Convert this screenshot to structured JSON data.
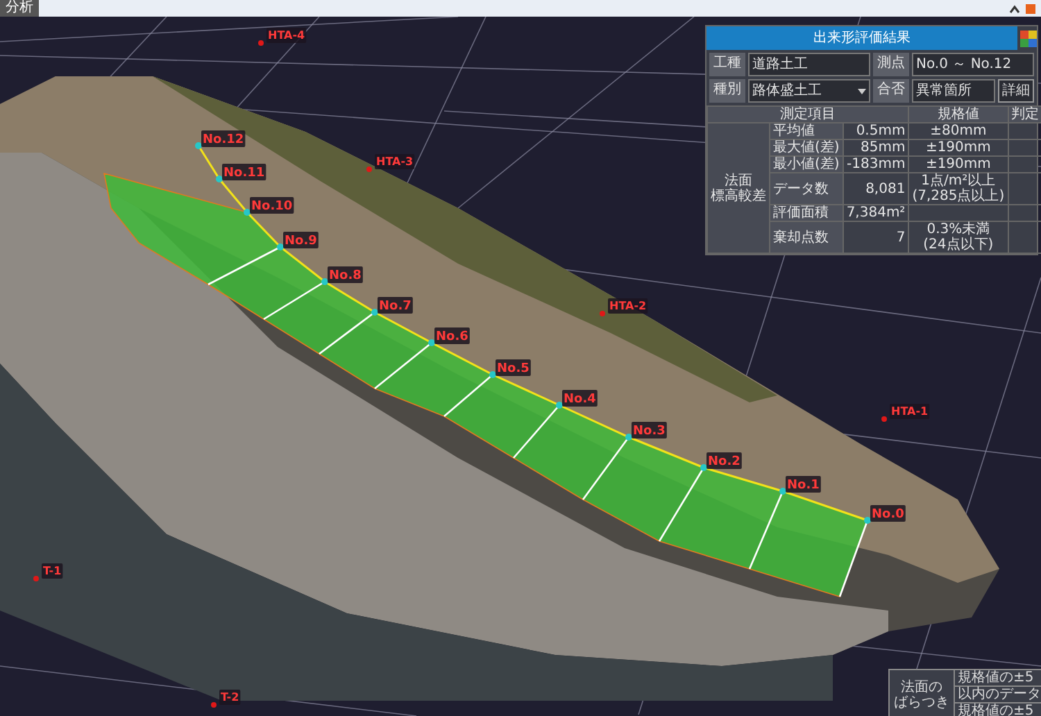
{
  "tab": {
    "label": "分析",
    "selected": true
  },
  "scene": {
    "stations": [
      "No.12",
      "No.11",
      "No.10",
      "No.9",
      "No.8",
      "No.7",
      "No.6",
      "No.5",
      "No.4",
      "No.3",
      "No.2",
      "No.1",
      "No.0"
    ],
    "control_points": [
      "HTA-4",
      "HTA-3",
      "HTA-2",
      "HTA-1",
      "T-1",
      "T-2"
    ]
  },
  "result_panel": {
    "title": "出来形評価結果",
    "fields": [
      {
        "label": "工種",
        "value": "道路土工",
        "kind": "text"
      },
      {
        "label": "測点",
        "value": "No.0 ～ No.12",
        "kind": "text"
      },
      {
        "label": "種別",
        "value": "路体盛土工",
        "kind": "select"
      },
      {
        "label": "合否",
        "value": "異常箇所",
        "kind": "text",
        "button": "詳細"
      }
    ],
    "columns": [
      "測定項目",
      "規格値",
      "判定"
    ],
    "group_lines": [
      "法面",
      "標高較差"
    ],
    "rows": [
      {
        "item": "平均値",
        "value": "0.5mm",
        "spec": [
          "±80mm"
        ]
      },
      {
        "item": "最大値(差)",
        "value": "85mm",
        "spec": [
          "±190mm"
        ]
      },
      {
        "item": "最小値(差)",
        "value": "-183mm",
        "spec": [
          "±190mm"
        ]
      },
      {
        "item": "データ数",
        "value": "8,081",
        "spec": [
          "1点/m²以上",
          "(7,285点以上)"
        ]
      },
      {
        "item": "評価面積",
        "value": "7,384m²",
        "spec": []
      },
      {
        "item": "棄却点数",
        "value": "7",
        "spec": [
          "0.3%未満",
          "(24点以下)"
        ]
      }
    ]
  },
  "legend": {
    "heading": [
      "法面の",
      "ばらつき"
    ],
    "lines": [
      "規格値の±5",
      "以内のデータ",
      "規格値の±5"
    ]
  }
}
